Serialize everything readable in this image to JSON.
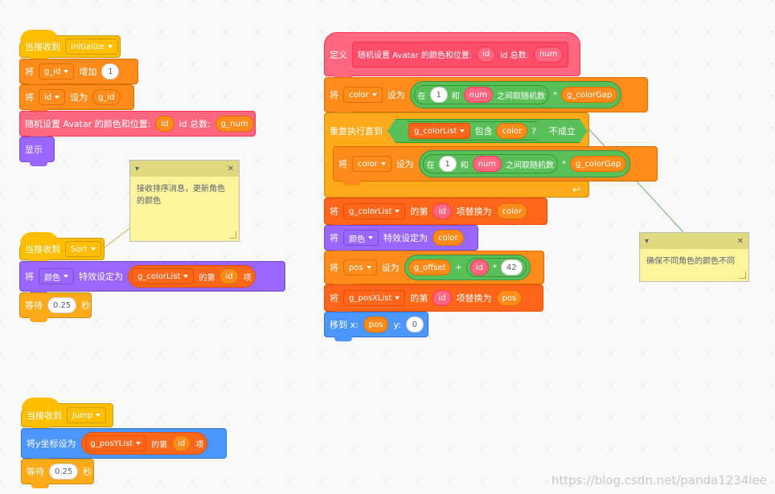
{
  "colors": {
    "events": "#ffbf00",
    "variables": "#ff8c1a",
    "lists": "#ff661a",
    "control": "#ffab19",
    "looks": "#9966ff",
    "motion": "#4c97ff",
    "myblocks": "#ff6680",
    "operators": "#59c059"
  },
  "script_init": {
    "hat_label": "当接收到",
    "msg": "Initialize",
    "b1": {
      "label": "将",
      "var": "g_id",
      "mid": "增加",
      "val": "1"
    },
    "b2": {
      "label": "将",
      "var": "id",
      "mid": "设为",
      "val": "g_id"
    },
    "b3": {
      "label": "随机设置 Avatar 的颜色和位置:",
      "arg1": "id",
      "mid": "id 总数:",
      "arg2": "g_num"
    },
    "b4": {
      "label": "显示"
    }
  },
  "script_sort": {
    "hat_label": "当接收到",
    "msg": "Sort",
    "b1": {
      "label": "将",
      "effect": "颜色",
      "mid": "特效设定为",
      "list": "g_colorList",
      "of": "的第",
      "idx": "id",
      "item": "项"
    },
    "b2": {
      "label": "等待",
      "val": "0.25",
      "unit": "秒"
    }
  },
  "script_jump": {
    "hat_label": "当接收到",
    "msg": "Jump",
    "b1": {
      "label": "将y坐标设为",
      "list": "g_posYList",
      "of": "的第",
      "idx": "id",
      "item": "项"
    },
    "b2": {
      "label": "等待",
      "val": "0.25",
      "unit": "秒"
    }
  },
  "script_define": {
    "def_label": "定义",
    "proc": "随机设置 Avatar 的颜色和位置:",
    "arg1": "id",
    "mid": "id 总数:",
    "arg2": "num",
    "b1": {
      "label": "将",
      "var": "color",
      "set": "设为",
      "in": "在",
      "from": "1",
      "and": "和",
      "to": "num",
      "rand": "之间取随机数",
      "mul": "*",
      "gap": "g_colorGap"
    },
    "loop": {
      "label": "重复执行直到",
      "list": "g_colorList",
      "contains": "包含",
      "item": "color",
      "q": "?",
      "not": "不成立"
    },
    "b2": {
      "label": "将",
      "var": "color",
      "set": "设为",
      "in": "在",
      "from": "1",
      "and": "和",
      "to": "num",
      "rand": "之间取随机数",
      "mul": "*",
      "gap": "g_colorGap"
    },
    "b3": {
      "label": "将",
      "list": "g_colorList",
      "of": "的第",
      "idx": "id",
      "replace": "项替换为",
      "val": "color"
    },
    "b4": {
      "label": "将",
      "effect": "颜色",
      "mid": "特效设定为",
      "val": "color"
    },
    "b5": {
      "label": "将",
      "var": "pos",
      "set": "设为",
      "offset": "g_offset",
      "plus": "+",
      "arg": "id",
      "mul": "*",
      "num": "42"
    },
    "b6": {
      "label": "将",
      "list": "g_posXList",
      "of": "的第",
      "idx": "id",
      "replace": "项替换为",
      "val": "pos"
    },
    "b7": {
      "label": "移到 x:",
      "x": "pos",
      "ylabel": "y:",
      "y": "0"
    }
  },
  "notes": [
    {
      "text": "接收排序消息，更新角色\n的颜色"
    },
    {
      "text": "确保不同角色的颜色不同"
    }
  ],
  "watermark": "https://blog.csdn.net/panda1234lee"
}
